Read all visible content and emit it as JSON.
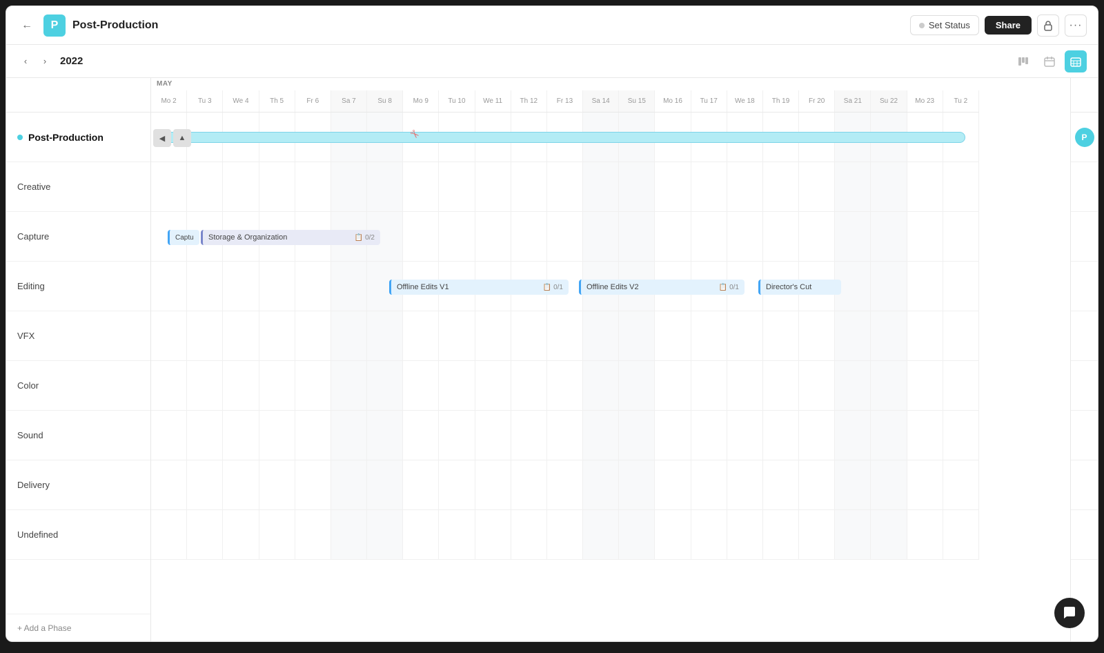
{
  "header": {
    "back_label": "←",
    "project_icon": "P",
    "project_title": "Post-Production",
    "set_status_label": "Set Status",
    "share_label": "Share",
    "lock_icon": "🔒",
    "more_icon": "···"
  },
  "toolbar": {
    "year": "2022",
    "nav_prev": "‹",
    "nav_next": "›",
    "flow_icon": "⋮⋮",
    "calendar_icon": "📅",
    "gantt_icon": "📊"
  },
  "month_label": "MAY",
  "days": [
    {
      "label": "Mo 2",
      "weekend": false
    },
    {
      "label": "Tu 3",
      "weekend": false
    },
    {
      "label": "We 4",
      "weekend": false
    },
    {
      "label": "Th 5",
      "weekend": false
    },
    {
      "label": "Fr 6",
      "weekend": false
    },
    {
      "label": "Sa 7",
      "weekend": true
    },
    {
      "label": "Su 8",
      "weekend": true
    },
    {
      "label": "Mo 9",
      "weekend": false
    },
    {
      "label": "Tu 10",
      "weekend": false
    },
    {
      "label": "We 11",
      "weekend": false
    },
    {
      "label": "Th 12",
      "weekend": false
    },
    {
      "label": "Fr 13",
      "weekend": false
    },
    {
      "label": "Sa 14",
      "weekend": true
    },
    {
      "label": "Su 15",
      "weekend": true
    },
    {
      "label": "Mo 16",
      "weekend": false
    },
    {
      "label": "Tu 17",
      "weekend": false
    },
    {
      "label": "We 18",
      "weekend": false
    },
    {
      "label": "Th 19",
      "weekend": false
    },
    {
      "label": "Fr 20",
      "weekend": false
    },
    {
      "label": "Sa 21",
      "weekend": true
    },
    {
      "label": "Su 22",
      "weekend": true
    },
    {
      "label": "Mo 23",
      "weekend": false
    },
    {
      "label": "Tu 2",
      "weekend": false
    }
  ],
  "phases": [
    {
      "id": "post-production",
      "label": "Post-Production",
      "main": true
    },
    {
      "id": "creative",
      "label": "Creative",
      "main": false
    },
    {
      "id": "capture",
      "label": "Capture",
      "main": false
    },
    {
      "id": "editing",
      "label": "Editing",
      "main": false
    },
    {
      "id": "vfx",
      "label": "VFX",
      "main": false
    },
    {
      "id": "color",
      "label": "Color",
      "main": false
    },
    {
      "id": "sound",
      "label": "Sound",
      "main": false
    },
    {
      "id": "delivery",
      "label": "Delivery",
      "main": false
    },
    {
      "id": "undefined",
      "label": "Undefined",
      "main": false
    }
  ],
  "add_phase_label": "+ Add a Phase",
  "tasks": {
    "capture": [
      {
        "label": "Captu",
        "left_pct": 4.5,
        "width_pct": 3,
        "style": "blue",
        "count": null
      },
      {
        "label": "Storage & Organization",
        "left_pct": 7,
        "width_pct": 25,
        "style": "default",
        "count": "0/2"
      }
    ],
    "editing": [
      {
        "label": "Offline Edits V1",
        "left_pct": 31,
        "width_pct": 29,
        "style": "blue",
        "count": "0/1"
      },
      {
        "label": "Offline Edits V2",
        "left_pct": 62,
        "width_pct": 28,
        "style": "blue",
        "count": "0/1"
      },
      {
        "label": "Director's Cut",
        "left_pct": 92,
        "width_pct": 8,
        "style": "blue",
        "count": null
      }
    ]
  },
  "chat_icon": "💬"
}
